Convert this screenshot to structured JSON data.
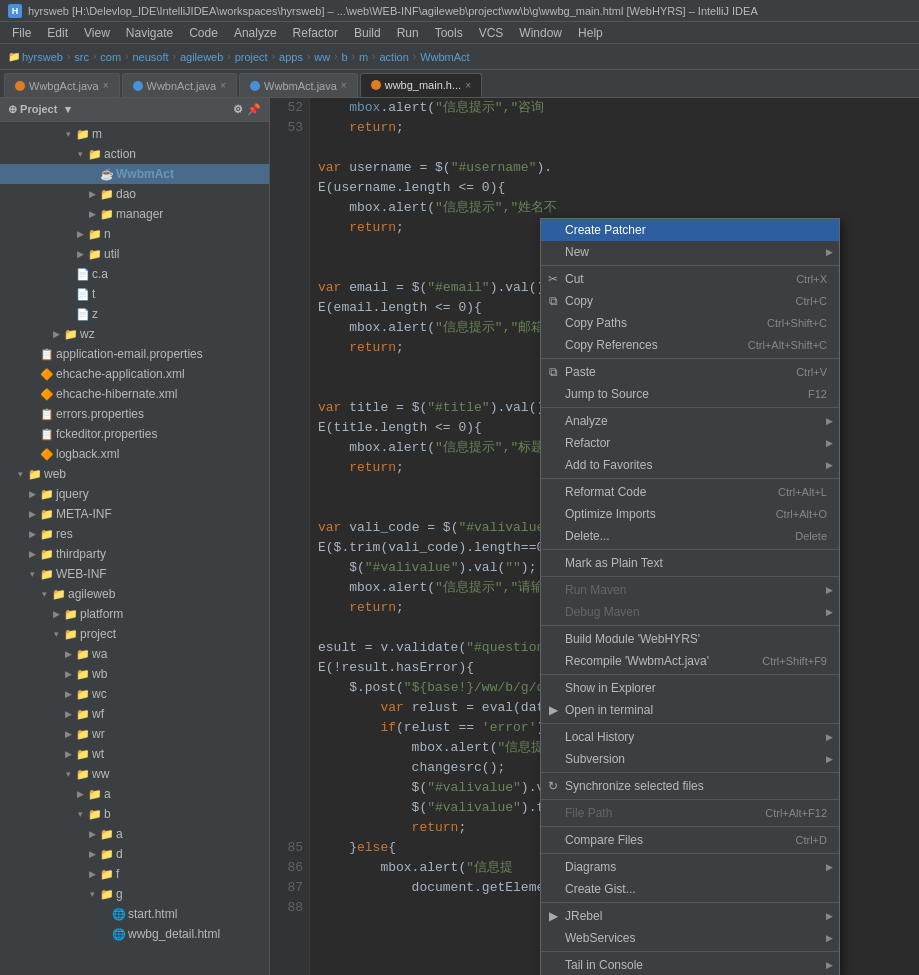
{
  "titleBar": {
    "icon": "H",
    "text": "hyrsweb [H:\\Delevlop_IDE\\IntelliJIDEA\\workspaces\\hyrsweb] – ...\\web\\WEB-INF\\agileweb\\project\\ww\\b\\g\\wwbg_main.html [WebHYRS] – IntelliJ IDEA"
  },
  "menuBar": {
    "items": [
      "File",
      "Edit",
      "View",
      "Navigate",
      "Code",
      "Analyze",
      "Refactor",
      "Build",
      "Run",
      "Tools",
      "VCS",
      "Window",
      "Help"
    ]
  },
  "pathBar": {
    "segments": [
      "hyrsweb",
      "src",
      "com",
      "neusoft",
      "agileweb",
      "project",
      "apps",
      "ww",
      "b",
      "m",
      "action",
      "WwbmAct"
    ]
  },
  "tabs": [
    {
      "id": "tab1",
      "label": "WwbgAct.java",
      "iconType": "orange",
      "active": false
    },
    {
      "id": "tab2",
      "label": "WwbnAct.java",
      "iconType": "blue",
      "active": false
    },
    {
      "id": "tab3",
      "label": "WwbmAct.java",
      "iconType": "blue",
      "active": false
    },
    {
      "id": "tab4",
      "label": "wwbg_main.h...",
      "iconType": "orange",
      "active": true
    }
  ],
  "sidebarHeader": {
    "label": "Project",
    "arrow": "▾"
  },
  "tree": [
    {
      "indent": 60,
      "open": true,
      "type": "folder",
      "label": "m"
    },
    {
      "indent": 72,
      "open": true,
      "type": "folder",
      "label": "action"
    },
    {
      "indent": 84,
      "open": false,
      "type": "javafile",
      "label": "WwbmAct",
      "selected": true
    },
    {
      "indent": 84,
      "open": false,
      "type": "folder",
      "label": "dao"
    },
    {
      "indent": 84,
      "open": false,
      "type": "folder",
      "label": "manager"
    },
    {
      "indent": 72,
      "open": false,
      "type": "folder",
      "label": "n"
    },
    {
      "indent": 72,
      "open": false,
      "type": "folder",
      "label": "util"
    },
    {
      "indent": 60,
      "open": false,
      "type": "file",
      "label": "c.a"
    },
    {
      "indent": 60,
      "open": false,
      "type": "file",
      "label": "t"
    },
    {
      "indent": 60,
      "open": false,
      "type": "file",
      "label": "z"
    },
    {
      "indent": 48,
      "open": false,
      "type": "folder",
      "label": "wz"
    },
    {
      "indent": 24,
      "open": false,
      "type": "properties",
      "label": "application-email.properties"
    },
    {
      "indent": 24,
      "open": false,
      "type": "xml",
      "label": "ehcache-application.xml"
    },
    {
      "indent": 24,
      "open": false,
      "type": "xml",
      "label": "ehcache-hibernate.xml"
    },
    {
      "indent": 24,
      "open": false,
      "type": "properties",
      "label": "errors.properties"
    },
    {
      "indent": 24,
      "open": false,
      "type": "properties",
      "label": "fckeditor.properties"
    },
    {
      "indent": 24,
      "open": false,
      "type": "xml",
      "label": "logback.xml"
    },
    {
      "indent": 12,
      "open": true,
      "type": "folder",
      "label": "web"
    },
    {
      "indent": 24,
      "open": false,
      "type": "folder",
      "label": "jquery"
    },
    {
      "indent": 24,
      "open": false,
      "type": "folder",
      "label": "META-INF"
    },
    {
      "indent": 24,
      "open": false,
      "type": "folder",
      "label": "res"
    },
    {
      "indent": 24,
      "open": false,
      "type": "folder",
      "label": "thirdparty"
    },
    {
      "indent": 24,
      "open": true,
      "type": "folder",
      "label": "WEB-INF"
    },
    {
      "indent": 36,
      "open": true,
      "type": "folder",
      "label": "agileweb"
    },
    {
      "indent": 48,
      "open": false,
      "type": "folder",
      "label": "platform"
    },
    {
      "indent": 48,
      "open": true,
      "type": "folder",
      "label": "project"
    },
    {
      "indent": 60,
      "open": false,
      "type": "folder",
      "label": "wa"
    },
    {
      "indent": 60,
      "open": false,
      "type": "folder",
      "label": "wb"
    },
    {
      "indent": 60,
      "open": false,
      "type": "folder",
      "label": "wc"
    },
    {
      "indent": 60,
      "open": false,
      "type": "folder",
      "label": "wf"
    },
    {
      "indent": 60,
      "open": false,
      "type": "folder",
      "label": "wr"
    },
    {
      "indent": 60,
      "open": false,
      "type": "folder",
      "label": "wt"
    },
    {
      "indent": 60,
      "open": true,
      "type": "folder",
      "label": "ww"
    },
    {
      "indent": 72,
      "open": false,
      "type": "folder",
      "label": "a"
    },
    {
      "indent": 72,
      "open": true,
      "type": "folder",
      "label": "b"
    },
    {
      "indent": 84,
      "open": false,
      "type": "folder",
      "label": "a"
    },
    {
      "indent": 84,
      "open": false,
      "type": "folder",
      "label": "d"
    },
    {
      "indent": 84,
      "open": false,
      "type": "folder",
      "label": "f"
    },
    {
      "indent": 84,
      "open": true,
      "type": "folder",
      "label": "g"
    },
    {
      "indent": 96,
      "open": false,
      "type": "htmlfile",
      "label": "start.html"
    },
    {
      "indent": 96,
      "open": false,
      "type": "htmlfile",
      "label": "wwbg_detail.html"
    }
  ],
  "lineNumbers": [
    "52",
    "53",
    "",
    "",
    "",
    "",
    "",
    "",
    "",
    "",
    "",
    "",
    "",
    "",
    "",
    "",
    "",
    "",
    "",
    "",
    "",
    "",
    "",
    "",
    "",
    "",
    "",
    "",
    "",
    "",
    "",
    "",
    "",
    "",
    "",
    "",
    "",
    "85",
    "86",
    "87",
    "88"
  ],
  "codeLines": [
    "    mbox.alert(\"信息提示\",\"咨询",
    "    return;",
    "",
    "ar username = $(\"#username\").",
    "E(username.length <= 0){",
    "    mbox.alert(\"信息提示\",\"姓名不",
    "    return;",
    "",
    "",
    "ar email = $(\"#email\").val();",
    "E(email.length <= 0){",
    "    mbox.alert(\"信息提示\",\"邮箱",
    "    return;",
    "",
    "",
    "ar title = $(\"#title\").val();",
    "E(title.length <= 0){",
    "    mbox.alert(\"信息提示\",\"标题不",
    "    return;",
    "",
    "",
    "ar vali_code = $(\"#valivalue\"",
    "E($.trim(vali_code).length==0",
    "    $(\"#valivalue\").val(\"\");",
    "    mbox.alert(\"信息提示\",\"请输入",
    "    return;",
    "",
    "esult = v.validate(\"#question",
    "E(!result.hasError){",
    "    $.post(\"${base!}/ww/b/g/qu",
    "        var relust = eval(data",
    "        if(relust == 'error'){",
    "            mbox.alert(\"信息提",
    "            changesrc();",
    "            $(\"#valivalue\").va",
    "            $(\"#valivalue\").fo",
    "            return;",
    "    }else{",
    "        mbox.alert(\"信息提",
    "            document.getEleme"
  ],
  "contextMenu": {
    "items": [
      {
        "id": "create-patcher",
        "label": "Create Patcher",
        "highlighted": true,
        "icon": ""
      },
      {
        "id": "new",
        "label": "New",
        "hasSubmenu": true,
        "icon": ""
      },
      {
        "id": "sep1",
        "type": "separator"
      },
      {
        "id": "cut",
        "label": "Cut",
        "shortcut": "Ctrl+X",
        "icon": "✂"
      },
      {
        "id": "copy",
        "label": "Copy",
        "shortcut": "Ctrl+C",
        "icon": "⧉"
      },
      {
        "id": "copy-paths",
        "label": "Copy Paths",
        "shortcut": "Ctrl+Shift+C",
        "icon": ""
      },
      {
        "id": "copy-references",
        "label": "Copy References",
        "shortcut": "Ctrl+Alt+Shift+C",
        "icon": ""
      },
      {
        "id": "sep2",
        "type": "separator"
      },
      {
        "id": "paste",
        "label": "Paste",
        "shortcut": "Ctrl+V",
        "icon": "⧉"
      },
      {
        "id": "jump-to-source",
        "label": "Jump to Source",
        "shortcut": "F12",
        "icon": ""
      },
      {
        "id": "sep3",
        "type": "separator"
      },
      {
        "id": "analyze",
        "label": "Analyze",
        "hasSubmenu": true,
        "icon": ""
      },
      {
        "id": "refactor",
        "label": "Refactor",
        "hasSubmenu": true,
        "icon": ""
      },
      {
        "id": "add-to-favorites",
        "label": "Add to Favorites",
        "hasSubmenu": true,
        "icon": ""
      },
      {
        "id": "sep4",
        "type": "separator"
      },
      {
        "id": "reformat-code",
        "label": "Reformat Code",
        "shortcut": "Ctrl+Alt+L",
        "icon": ""
      },
      {
        "id": "optimize-imports",
        "label": "Optimize Imports",
        "shortcut": "Ctrl+Alt+O",
        "icon": ""
      },
      {
        "id": "delete",
        "label": "Delete...",
        "shortcut": "Delete",
        "icon": ""
      },
      {
        "id": "sep5",
        "type": "separator"
      },
      {
        "id": "mark-plain-text",
        "label": "Mark as Plain Text",
        "icon": ""
      },
      {
        "id": "sep6",
        "type": "separator"
      },
      {
        "id": "run-maven",
        "label": "Run Maven",
        "hasSubmenu": true,
        "disabled": true,
        "icon": ""
      },
      {
        "id": "debug-maven",
        "label": "Debug Maven",
        "hasSubmenu": true,
        "disabled": true,
        "icon": ""
      },
      {
        "id": "sep7",
        "type": "separator"
      },
      {
        "id": "build-module",
        "label": "Build Module 'WebHYRS'",
        "icon": ""
      },
      {
        "id": "recompile",
        "label": "Recompile 'WwbmAct.java'",
        "shortcut": "Ctrl+Shift+F9",
        "icon": ""
      },
      {
        "id": "sep8",
        "type": "separator"
      },
      {
        "id": "show-in-explorer",
        "label": "Show in Explorer",
        "icon": ""
      },
      {
        "id": "open-in-terminal",
        "label": "Open in terminal",
        "icon": "▶"
      },
      {
        "id": "sep9",
        "type": "separator"
      },
      {
        "id": "local-history",
        "label": "Local History",
        "hasSubmenu": true,
        "icon": ""
      },
      {
        "id": "subversion",
        "label": "Subversion",
        "hasSubmenu": true,
        "icon": ""
      },
      {
        "id": "sep10",
        "type": "separator"
      },
      {
        "id": "synchronize",
        "label": "Synchronize selected files",
        "icon": "↻"
      },
      {
        "id": "sep11",
        "type": "separator"
      },
      {
        "id": "file-path",
        "label": "File Path",
        "shortcut": "Ctrl+Alt+F12",
        "disabled": true,
        "icon": ""
      },
      {
        "id": "sep12",
        "type": "separator"
      },
      {
        "id": "compare-files",
        "label": "Compare Files",
        "shortcut": "Ctrl+D",
        "icon": ""
      },
      {
        "id": "sep13",
        "type": "separator"
      },
      {
        "id": "diagrams",
        "label": "Diagrams",
        "hasSubmenu": true,
        "icon": ""
      },
      {
        "id": "create-gist",
        "label": "Create Gist...",
        "icon": ""
      },
      {
        "id": "sep14",
        "type": "separator"
      },
      {
        "id": "jrebel",
        "label": "JRebel",
        "hasSubmenu": true,
        "icon": "▶"
      },
      {
        "id": "web-services",
        "label": "WebServices",
        "hasSubmenu": true,
        "icon": ""
      },
      {
        "id": "sep15",
        "type": "separator"
      },
      {
        "id": "tail-in-console",
        "label": "Tail in Console",
        "hasSubmenu": true,
        "icon": ""
      }
    ]
  }
}
